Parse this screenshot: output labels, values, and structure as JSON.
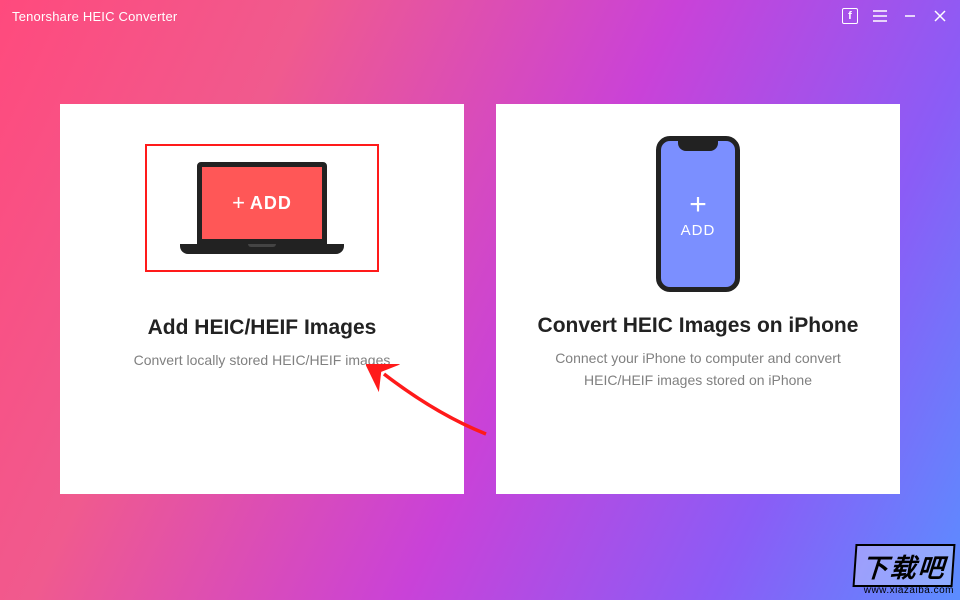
{
  "titlebar": {
    "title": "Tenorshare HEIC Converter"
  },
  "cards": {
    "left": {
      "add_label": "ADD",
      "title": "Add HEIC/HEIF Images",
      "subtitle": "Convert locally stored HEIC/HEIF images"
    },
    "right": {
      "add_label": "ADD",
      "title": "Convert HEIC Images on iPhone",
      "subtitle": "Connect your iPhone to computer and convert HEIC/HEIF images stored on iPhone"
    }
  },
  "watermark": {
    "text": "下载吧",
    "url": "www.xiazaiba.com"
  },
  "colors": {
    "highlight_border": "#ff1a1a",
    "laptop_screen": "#ff5757",
    "phone_body": "#7b8fff"
  }
}
